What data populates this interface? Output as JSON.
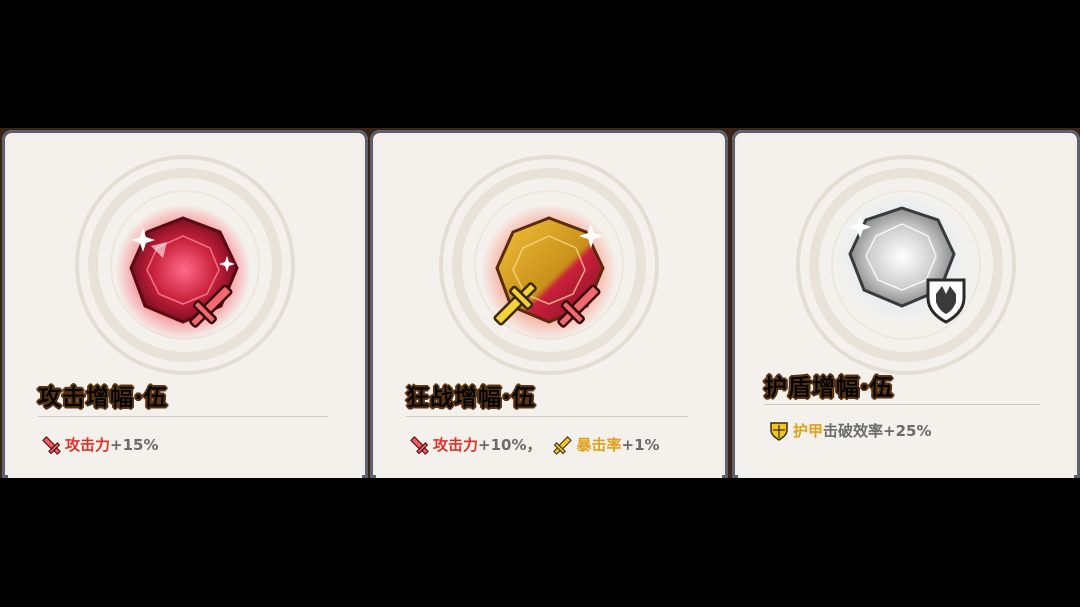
{
  "cards": [
    {
      "title": "攻击增幅·伍",
      "gem_color": "#d8283a",
      "icon": "sword-icon",
      "effects": [
        {
          "stat": "攻击力",
          "value": "+15%",
          "icon": "sword-icon"
        }
      ]
    },
    {
      "title": "狂战增幅·伍",
      "gem_color": "#d8a21a",
      "icon": "crit-sword-icon",
      "effects": [
        {
          "stat": "攻击力",
          "value": "+10%，",
          "icon": "sword-icon"
        },
        {
          "stat": "暴击率",
          "value": "+1%",
          "icon": "crit-sword-icon"
        }
      ]
    },
    {
      "title": "护盾增幅·伍",
      "gem_color": "#c9c9c9",
      "icon": "broken-shield-icon",
      "effects": [
        {
          "stat_highlight": "护甲",
          "stat_rest": "击破效率",
          "value": "+25%",
          "icon": "shield-icon"
        }
      ]
    }
  ]
}
